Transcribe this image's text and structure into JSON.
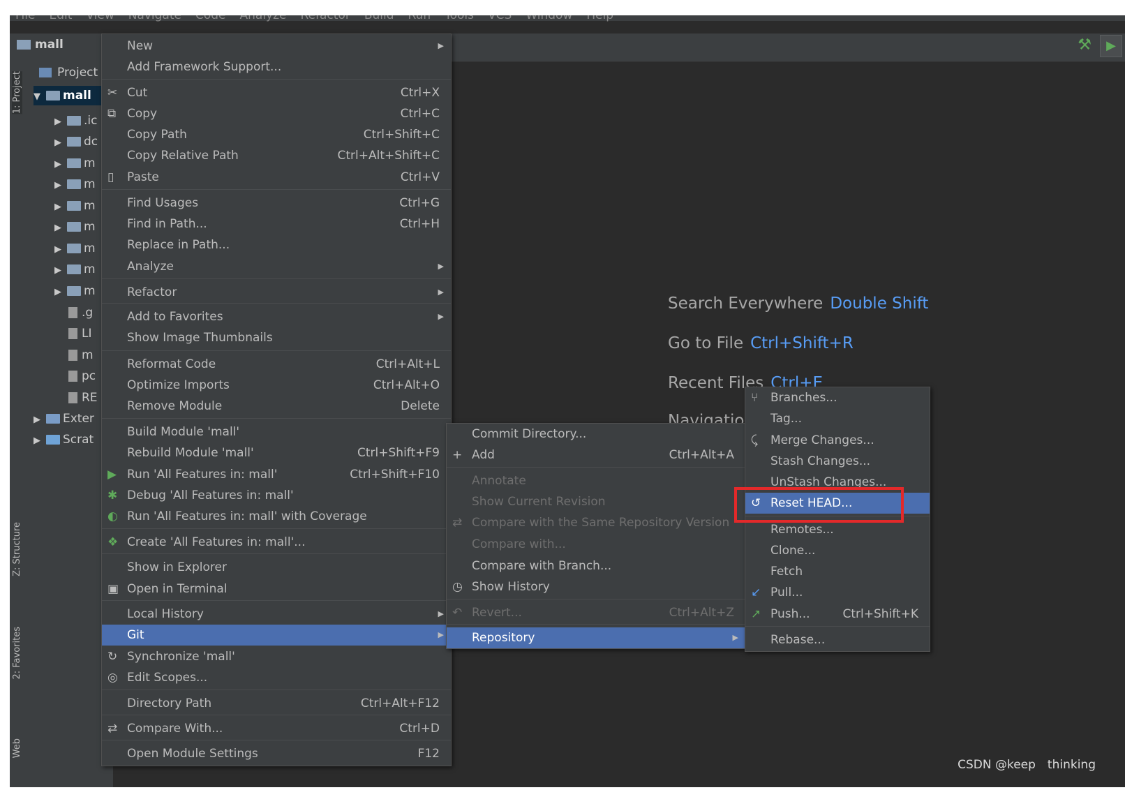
{
  "menubar": [
    "File",
    "Edit",
    "View",
    "Navigate",
    "Code",
    "Analyze",
    "Refactor",
    "Build",
    "Run",
    "Tools",
    "VCS",
    "Window",
    "Help"
  ],
  "navbar": {
    "project": "mall"
  },
  "toolwindows": {
    "project": "1: Project",
    "structure": "Z: Structure",
    "favorites": "2: Favorites",
    "web": "Web"
  },
  "project_panel": {
    "header": "Project",
    "rows": [
      ".ic",
      "dc",
      "m",
      "m",
      "m",
      "m",
      "m",
      "m",
      "m",
      ".g",
      "LI",
      "m",
      "pc",
      "RE",
      "Exter",
      "Scrat"
    ],
    "root": "mall"
  },
  "editor": {
    "hints": [
      {
        "label": "Search Everywhere",
        "key": "Double Shift"
      },
      {
        "label": "Go to File",
        "key": "Ctrl+Shift+R"
      },
      {
        "label": "Recent Files",
        "key": "Ctrl+E"
      },
      {
        "label": "Navigation",
        "key": ""
      }
    ]
  },
  "context_menu": [
    {
      "label": "New",
      "submenu": true
    },
    {
      "label": "Add Framework Support..."
    },
    {
      "label": "Cut",
      "shortcut": "Ctrl+X",
      "icon": "scissors-icon"
    },
    {
      "label": "Copy",
      "shortcut": "Ctrl+C",
      "icon": "copy-icon"
    },
    {
      "label": "Copy Path",
      "shortcut": "Ctrl+Shift+C"
    },
    {
      "label": "Copy Relative Path",
      "shortcut": "Ctrl+Alt+Shift+C"
    },
    {
      "label": "Paste",
      "shortcut": "Ctrl+V",
      "icon": "paste-icon"
    },
    {
      "label": "Find Usages",
      "shortcut": "Ctrl+G"
    },
    {
      "label": "Find in Path...",
      "shortcut": "Ctrl+H"
    },
    {
      "label": "Replace in Path..."
    },
    {
      "label": "Analyze",
      "submenu": true
    },
    {
      "label": "Refactor",
      "submenu": true
    },
    {
      "label": "Add to Favorites",
      "submenu": true
    },
    {
      "label": "Show Image Thumbnails"
    },
    {
      "label": "Reformat Code",
      "shortcut": "Ctrl+Alt+L"
    },
    {
      "label": "Optimize Imports",
      "shortcut": "Ctrl+Alt+O"
    },
    {
      "label": "Remove Module",
      "shortcut": "Delete"
    },
    {
      "label": "Build Module 'mall'"
    },
    {
      "label": "Rebuild Module 'mall'",
      "shortcut": "Ctrl+Shift+F9"
    },
    {
      "label": "Run 'All Features in: mall'",
      "shortcut": "Ctrl+Shift+F10",
      "icon": "run-icon"
    },
    {
      "label": "Debug 'All Features in: mall'",
      "icon": "debug-icon"
    },
    {
      "label": "Run 'All Features in: mall' with Coverage",
      "icon": "coverage-icon"
    },
    {
      "label": "Create 'All Features in: mall'...",
      "icon": "create-config-icon"
    },
    {
      "label": "Show in Explorer"
    },
    {
      "label": "Open in Terminal",
      "icon": "terminal-icon"
    },
    {
      "label": "Local History",
      "submenu": true
    },
    {
      "label": "Git",
      "submenu": true,
      "selected": true
    },
    {
      "label": "Synchronize 'mall'",
      "icon": "sync-icon"
    },
    {
      "label": "Edit Scopes...",
      "icon": "scope-icon"
    },
    {
      "label": "Directory Path",
      "shortcut": "Ctrl+Alt+F12"
    },
    {
      "label": "Compare With...",
      "shortcut": "Ctrl+D",
      "icon": "compare-icon"
    },
    {
      "label": "Open Module Settings",
      "shortcut": "F12"
    }
  ],
  "git_submenu": [
    {
      "label": "Commit Directory..."
    },
    {
      "label": "Add",
      "shortcut": "Ctrl+Alt+A",
      "icon": "plus-icon"
    },
    {
      "label": "Annotate",
      "disabled": true
    },
    {
      "label": "Show Current Revision",
      "disabled": true
    },
    {
      "label": "Compare with the Same Repository Version",
      "disabled": true,
      "icon": "compare-icon"
    },
    {
      "label": "Compare with...",
      "disabled": true
    },
    {
      "label": "Compare with Branch..."
    },
    {
      "label": "Show History",
      "icon": "clock-icon"
    },
    {
      "label": "Revert...",
      "shortcut": "Ctrl+Alt+Z",
      "disabled": true,
      "icon": "revert-icon"
    },
    {
      "label": "Repository",
      "submenu": true,
      "selected": true
    }
  ],
  "repository_submenu": [
    {
      "label": "Branches...",
      "icon": "branch-icon"
    },
    {
      "label": "Tag..."
    },
    {
      "label": "Merge Changes...",
      "icon": "merge-icon"
    },
    {
      "label": "Stash Changes..."
    },
    {
      "label": "UnStash Changes..."
    },
    {
      "label": "Reset HEAD...",
      "icon": "reset-icon",
      "selected": true
    },
    {
      "label": "Remotes..."
    },
    {
      "label": "Clone..."
    },
    {
      "label": "Fetch"
    },
    {
      "label": "Pull...",
      "icon": "pull-icon"
    },
    {
      "label": "Push...",
      "shortcut": "Ctrl+Shift+K",
      "icon": "push-icon"
    },
    {
      "label": "Rebase..."
    }
  ],
  "watermark": "CSDN @keep　thinking",
  "colors": {
    "selection": "#4b6eaf",
    "highlight_box": "#e3292a",
    "hint_key": "#589df6"
  }
}
